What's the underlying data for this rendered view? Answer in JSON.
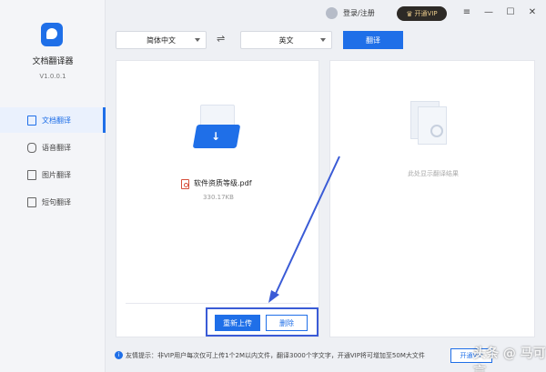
{
  "app": {
    "name": "文档翻译器",
    "version": "V1.0.0.1"
  },
  "sidebar": {
    "items": [
      {
        "label": "文档翻译",
        "icon": "document-icon",
        "active": true
      },
      {
        "label": "语音翻译",
        "icon": "microphone-icon",
        "active": false
      },
      {
        "label": "图片翻译",
        "icon": "image-icon",
        "active": false
      },
      {
        "label": "短句翻译",
        "icon": "text-icon",
        "active": false
      }
    ]
  },
  "topbar": {
    "login_label": "登录/注册",
    "vip_label": "开通VIP",
    "window_controls": {
      "menu": "≡",
      "minimize": "—",
      "maximize": "☐",
      "close": "✕"
    }
  },
  "translate_bar": {
    "source_lang": "简体中文",
    "target_lang": "英文",
    "swap_icon": "⇌",
    "translate_label": "翻译"
  },
  "source_panel": {
    "file_name": "软件资质等级.pdf",
    "file_size": "330.17KB",
    "reupload_label": "重新上传",
    "delete_label": "删除"
  },
  "result_panel": {
    "hint": "此处显示翻译结果"
  },
  "footer": {
    "tip_icon": "i",
    "tip": "友情提示：非VIP用户每次仅可上传1个2M以内文件，翻译3000个字文字，开通VIP将可增加至50M大文件",
    "open_vip_label": "开通VIP",
    "watermark": "头条 @ 马可言"
  },
  "colors": {
    "accent": "#1f6fe8",
    "annotation": "#3a5bd6",
    "vip_bg": "#2d2a26",
    "vip_text": "#e8c98a"
  }
}
